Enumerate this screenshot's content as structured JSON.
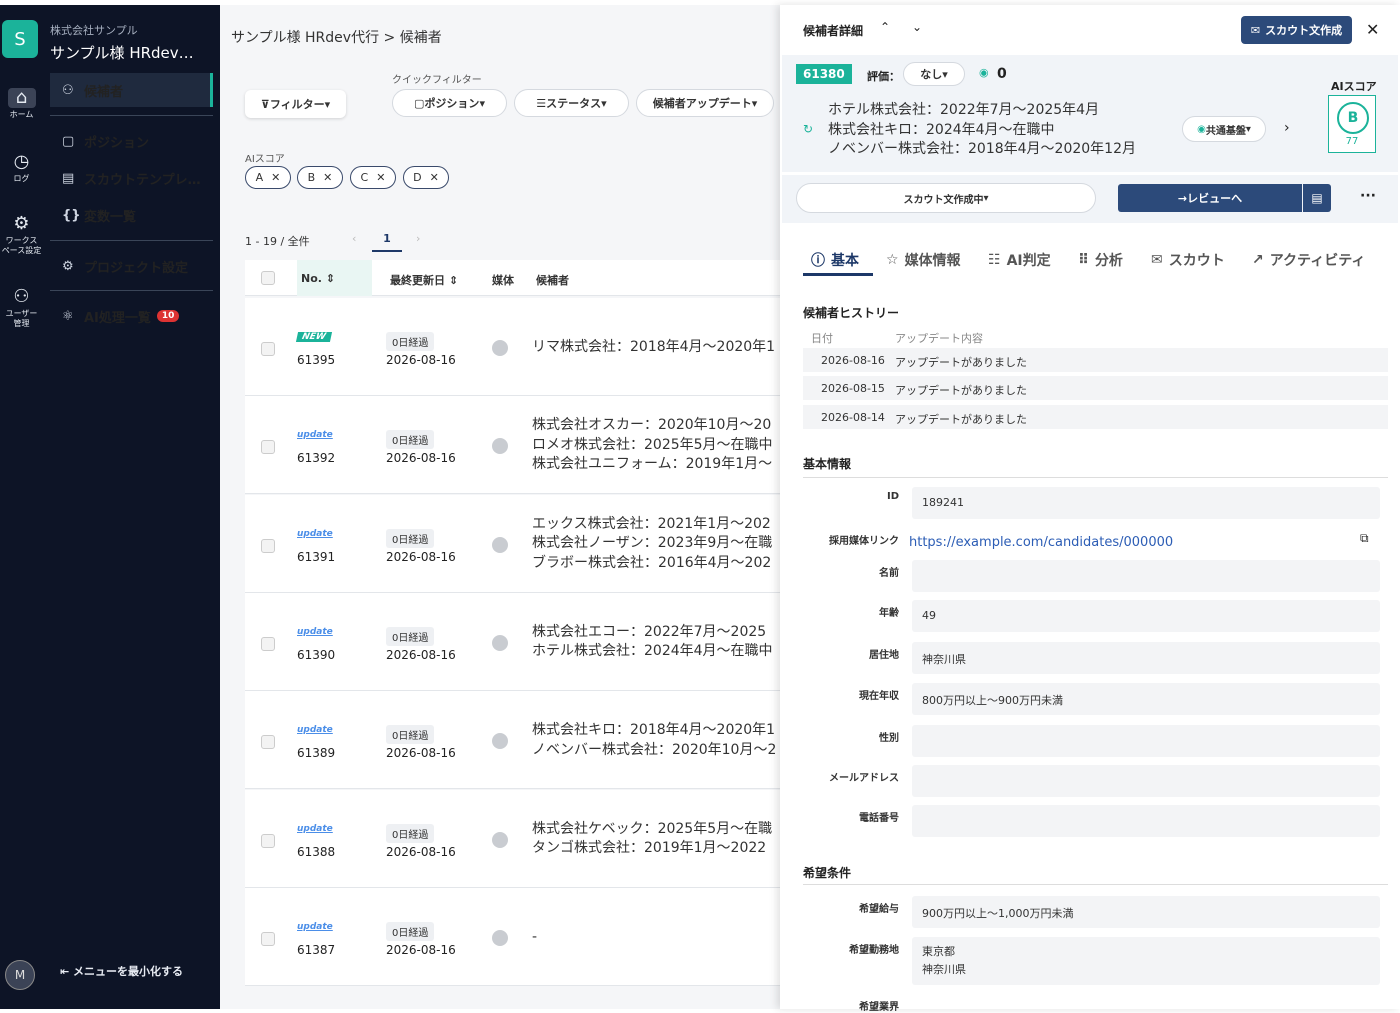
{
  "rail": {
    "logo": "S",
    "items": [
      {
        "label": "ホーム",
        "icon": "⌂"
      },
      {
        "label": "ログ",
        "icon": "◷"
      },
      {
        "label": "ワークス\nペース設定",
        "icon": "⚙"
      },
      {
        "label": "ユーザー\n管理",
        "icon": "⚇"
      }
    ],
    "avatar": "M"
  },
  "sidebar": {
    "company": "株式会社サンプル",
    "project": "サンプル様 HRdev…",
    "items": [
      {
        "label": "候補者",
        "icon": "⚇"
      },
      {
        "label": "ポジション",
        "icon": "▢"
      },
      {
        "label": "スカウトテンプレ…",
        "icon": "▤"
      },
      {
        "label": "変数一覧",
        "icon": "{}"
      },
      {
        "label": "プロジェクト設定",
        "icon": "⚙"
      },
      {
        "label": "AI処理一覧",
        "icon": "⚛",
        "badge": "10"
      }
    ],
    "minimize": "メニューを最小化する"
  },
  "main": {
    "breadcrumb": "サンプル様 HRdev代行 > 候補者",
    "filter_button": "フィルター",
    "quick_filter_label": "クイックフィルター",
    "quick_filters": [
      {
        "label": "ポジション",
        "icon": "▢"
      },
      {
        "label": "ステータス",
        "icon": "☰"
      },
      {
        "label": "候補者アップデート",
        "icon": ""
      }
    ],
    "ai_score_label": "AIスコア",
    "ai_chips": [
      "A",
      "B",
      "C",
      "D"
    ],
    "count_text": "1 - 19 / 全件",
    "page": "1",
    "columns": {
      "no": "No.",
      "updated": "最終更新日",
      "media": "媒体",
      "candidate": "候補者"
    },
    "rows": [
      {
        "tag": "NEW",
        "no": "61395",
        "days": "0日経過",
        "date": "2026-08-16",
        "history": [
          "リマ株式会社：2018年4月～2020年1"
        ]
      },
      {
        "tag": "update",
        "no": "61392",
        "days": "0日経過",
        "date": "2026-08-16",
        "history": [
          "株式会社オスカー：2020年10月～20",
          "ロメオ株式会社：2025年5月～在職中",
          "株式会社ユニフォーム：2019年1月～"
        ]
      },
      {
        "tag": "update",
        "no": "61391",
        "days": "0日経過",
        "date": "2026-08-16",
        "history": [
          "エックス株式会社：2021年1月～202",
          "株式会社ノーザン：2023年9月～在職",
          "ブラボー株式会社：2016年4月～202"
        ]
      },
      {
        "tag": "update",
        "no": "61390",
        "days": "0日経過",
        "date": "2026-08-16",
        "history": [
          "株式会社エコー：2022年7月～2025",
          "ホテル株式会社：2024年4月～在職中"
        ]
      },
      {
        "tag": "update",
        "no": "61389",
        "days": "0日経過",
        "date": "2026-08-16",
        "history": [
          "株式会社キロ：2018年4月～2020年1",
          "ノベンバー株式会社：2020年10月～2"
        ]
      },
      {
        "tag": "update",
        "no": "61388",
        "days": "0日経過",
        "date": "2026-08-16",
        "history": [
          "株式会社ケベック：2025年5月～在職",
          "タンゴ株式会社：2019年1月～2022"
        ]
      },
      {
        "tag": "update",
        "no": "61387",
        "days": "0日経過",
        "date": "2026-08-16",
        "history": [
          "-"
        ]
      }
    ]
  },
  "panel": {
    "title": "候補者詳細",
    "scout_button": "スカウト文作成",
    "candidate_id": "61380",
    "rating_label": "評価：",
    "rating_value": "なし",
    "message_count": "0",
    "ai_score_label": "AIスコア",
    "ai_grade": "B",
    "ai_score": "77",
    "history": [
      "ホテル株式会社：2022年7月～2025年4月",
      "株式会社キロ：2024年4月～在職中",
      "ノベンバー株式会社：2018年4月～2020年12月"
    ],
    "kiban": "共通基盤",
    "status_select": "スカウト文作成中",
    "review_button": "レビューへ",
    "tabs": [
      {
        "label": "基本",
        "icon": "ⓘ"
      },
      {
        "label": "媒体情報",
        "icon": "☆"
      },
      {
        "label": "AI判定",
        "icon": "☷"
      },
      {
        "label": "分析",
        "icon": "⋮⋮"
      },
      {
        "label": "スカウト",
        "icon": "✉"
      },
      {
        "label": "アクティビティ",
        "icon": "↗"
      }
    ],
    "history_section": "候補者ヒストリー",
    "history_headers": {
      "date": "日付",
      "content": "アップデート内容"
    },
    "history_rows": [
      {
        "date": "2026-08-16",
        "content": "アップデートがありました"
      },
      {
        "date": "2026-08-15",
        "content": "アップデートがありました"
      },
      {
        "date": "2026-08-14",
        "content": "アップデートがありました"
      }
    ],
    "basic_section": "基本情報",
    "fields": {
      "id": {
        "label": "ID",
        "value": "189241"
      },
      "link": {
        "label": "採用媒体リンク",
        "value": "https://example.com/candidates/000000"
      },
      "name": {
        "label": "名前",
        "value": ""
      },
      "age": {
        "label": "年齢",
        "value": "49"
      },
      "residence": {
        "label": "居住地",
        "value": "神奈川県"
      },
      "income": {
        "label": "現在年収",
        "value": "800万円以上～900万円未満"
      },
      "gender": {
        "label": "性別",
        "value": ""
      },
      "email": {
        "label": "メールアドレス",
        "value": ""
      },
      "phone": {
        "label": "電話番号",
        "value": ""
      }
    },
    "pref_section": "希望条件",
    "pref_fields": {
      "salary": {
        "label": "希望給与",
        "value": "900万円以上～1,000万円未満"
      },
      "location": {
        "label": "希望勤務地",
        "value": "東京都\n神奈川県"
      },
      "industry": {
        "label": "希望業界",
        "value": ""
      }
    }
  }
}
